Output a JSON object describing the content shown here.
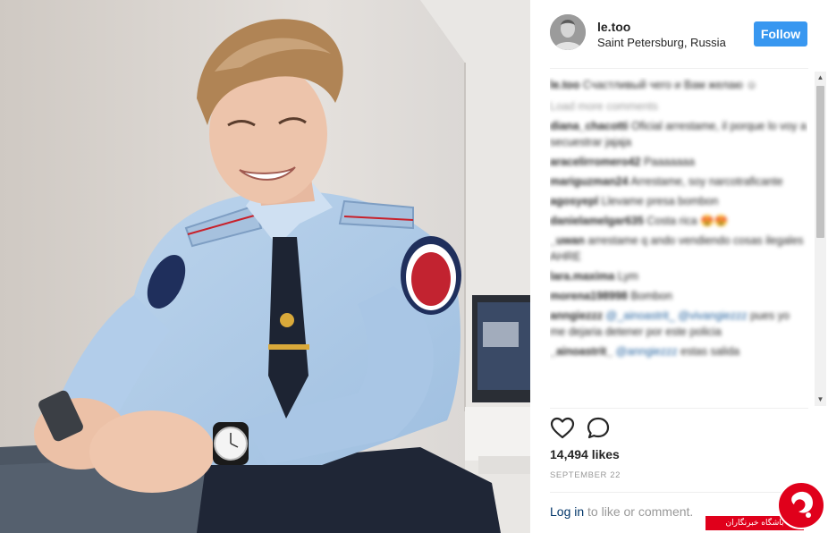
{
  "post": {
    "username": "le.too",
    "location": "Saint Petersburg, Russia",
    "follow_label": "Follow"
  },
  "comments": {
    "caption_user": "le.too",
    "caption_text": "Счастливый чего и Вам желаю ☺",
    "load_more": "Load more comments",
    "items": [
      {
        "user": "diana_chacotti",
        "text": "Oficial arrestame, il porque lo voy a secuestrar jajaja"
      },
      {
        "user": "aracelirromero42",
        "text": "Paaaaaaa"
      },
      {
        "user": "mariguzman24",
        "text": "Arrestame, soy narcotraficante"
      },
      {
        "user": "agosyepl",
        "text": "Llevame presa bombon"
      },
      {
        "user": "danielamelgar635",
        "text": "Costa rica 😍😍"
      },
      {
        "user": "_uwan",
        "text": "arrestame q ando vendiendo cosas ilegales AHRE"
      },
      {
        "user": "lara.maxima",
        "text": "Lym"
      },
      {
        "user": "morena198998",
        "text": "Bombon"
      },
      {
        "user": "anngiezzz",
        "mention": "@_ainoastrit_ @vivangiezzz",
        "text": "pues yo me dejaria detener por este policia"
      },
      {
        "user": "_ainoastrit_",
        "mention": "@anngiezzz",
        "text": "estas salida"
      }
    ]
  },
  "actions": {
    "like_icon": "heart-outline-icon",
    "comment_icon": "speech-bubble-icon"
  },
  "meta": {
    "likes": "14,494 likes",
    "date": "SEPTEMBER 22",
    "login_link": "Log in",
    "login_rest": " to like or comment."
  },
  "watermark": {
    "text": "باشگاه خبرنگاران",
    "brand_color": "#e0001b"
  },
  "colors": {
    "accent": "#3897f0",
    "text": "#262626",
    "muted": "#999999",
    "link": "#003569"
  }
}
